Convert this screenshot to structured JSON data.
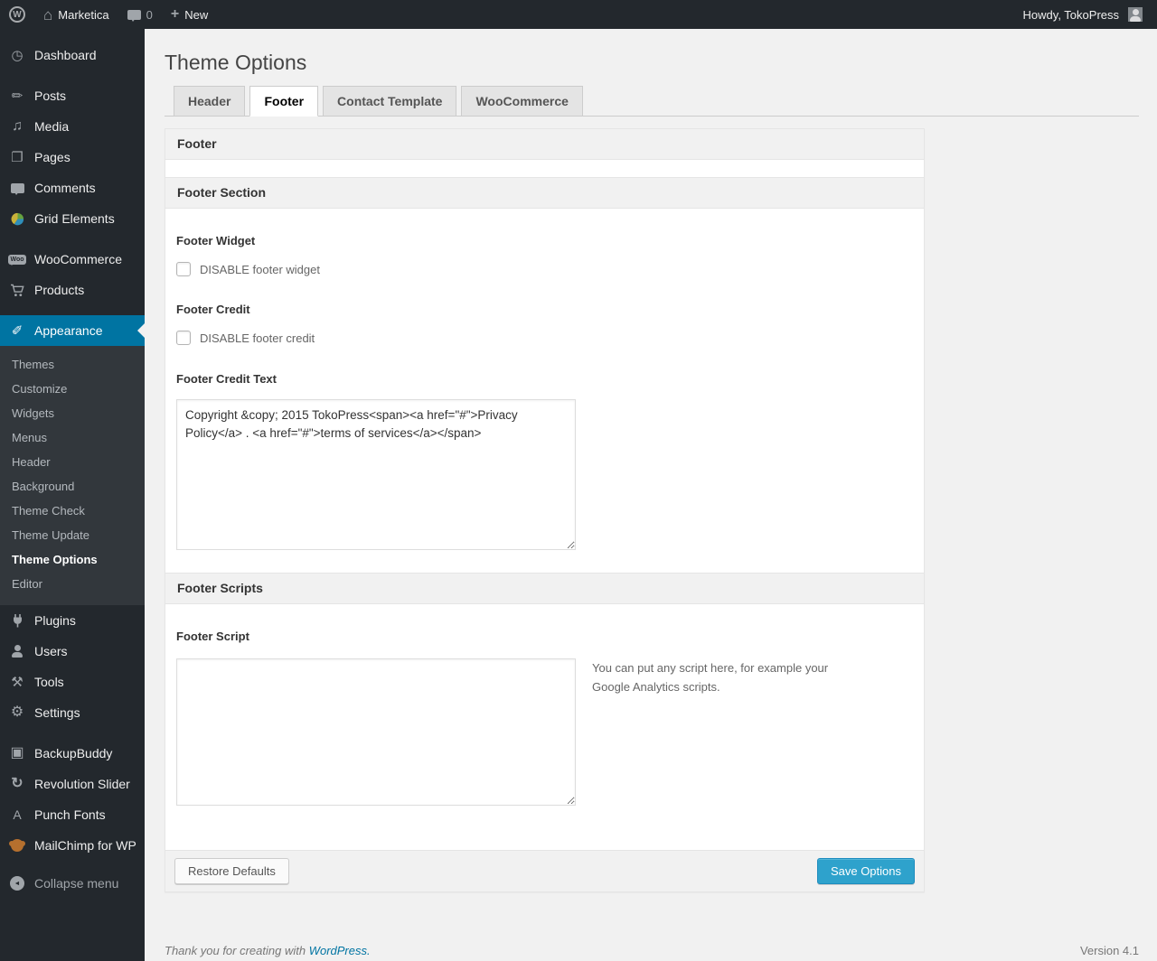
{
  "admin_bar": {
    "site_name": "Marketica",
    "comments_count": "0",
    "new_label": "New",
    "howdy_text": "Howdy, TokoPress"
  },
  "sidebar": {
    "items": [
      {
        "label": "Dashboard",
        "icon": "dashboard-icon"
      },
      {
        "label": "Posts",
        "icon": "pushpin-icon"
      },
      {
        "label": "Media",
        "icon": "media-icon"
      },
      {
        "label": "Pages",
        "icon": "pages-icon"
      },
      {
        "label": "Comments",
        "icon": "comment-bubble-icon"
      },
      {
        "label": "Grid Elements",
        "icon": "grid-elements-icon"
      },
      {
        "label": "WooCommerce",
        "icon": "woocommerce-badge-icon",
        "badge_text": "Woo"
      },
      {
        "label": "Products",
        "icon": "cart-icon"
      },
      {
        "label": "Appearance",
        "icon": "paintbrush-icon",
        "active": true
      },
      {
        "label": "Plugins",
        "icon": "plug-icon"
      },
      {
        "label": "Users",
        "icon": "person-icon"
      },
      {
        "label": "Tools",
        "icon": "tools-icon"
      },
      {
        "label": "Settings",
        "icon": "settings-icon"
      },
      {
        "label": "BackupBuddy",
        "icon": "backup-drive-icon"
      },
      {
        "label": "Revolution Slider",
        "icon": "rotate-arrows-icon"
      },
      {
        "label": "Punch Fonts",
        "icon": "letter-a-icon"
      },
      {
        "label": "MailChimp for WP",
        "icon": "monkey-icon"
      },
      {
        "label": "Collapse menu",
        "icon": "collapse-arrow-icon"
      }
    ],
    "appearance_submenu": {
      "items": [
        "Themes",
        "Customize",
        "Widgets",
        "Menus",
        "Header",
        "Background",
        "Theme Check",
        "Theme Update",
        "Theme Options",
        "Editor"
      ],
      "current": "Theme Options"
    }
  },
  "main": {
    "page_title": "Theme Options",
    "tabs": [
      {
        "label": "Header",
        "active": false
      },
      {
        "label": "Footer",
        "active": true
      },
      {
        "label": "Contact Template",
        "active": false
      },
      {
        "label": "WooCommerce",
        "active": false
      }
    ],
    "panel": {
      "header": "Footer",
      "section_title": "Footer Section",
      "footer_widget": {
        "label": "Footer Widget",
        "checkbox_label": "DISABLE footer widget",
        "checked": false
      },
      "footer_credit": {
        "label": "Footer Credit",
        "checkbox_label": "DISABLE footer credit",
        "checked": false
      },
      "footer_credit_text": {
        "label": "Footer Credit Text",
        "value": "Copyright &copy; 2015 TokoPress<span><a href=\"#\">Privacy Policy</a> . <a href=\"#\">terms of services</a></span>"
      },
      "scripts_section_title": "Footer Scripts",
      "footer_script": {
        "label": "Footer Script",
        "value": "",
        "hint": "You can put any script here, for example your Google Analytics scripts."
      },
      "restore_button_label": "Restore Defaults",
      "save_button_label": "Save Options"
    },
    "page_footer": {
      "thanks_text": "Thank you for creating with",
      "wordpress_link": "WordPress.",
      "version": "Version 4.1"
    }
  },
  "colors": {
    "accent_blue": "#0074a2",
    "primary_button_blue": "#2ea2cc",
    "admin_dark": "#23282d",
    "page_background": "#f1f1f1"
  }
}
